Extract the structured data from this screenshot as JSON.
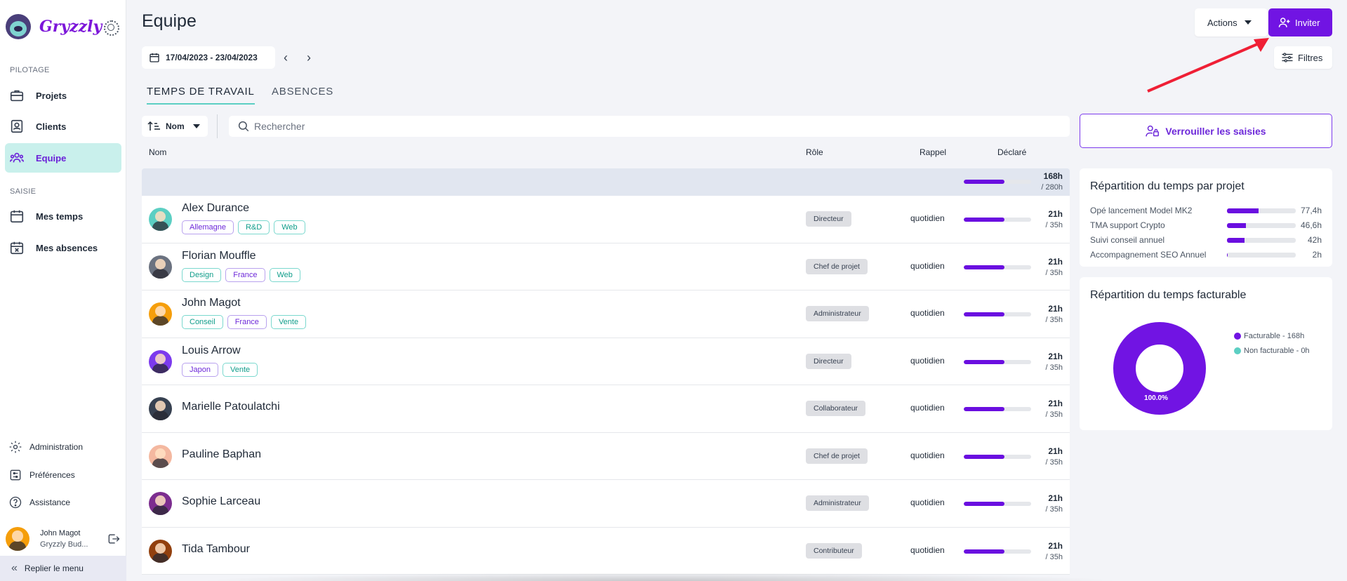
{
  "app": {
    "name": "Gryzzly"
  },
  "sidebar": {
    "sections": [
      {
        "label": "PILOTAGE",
        "items": [
          {
            "label": "Projets",
            "icon": "briefcase-icon"
          },
          {
            "label": "Clients",
            "icon": "contact-book-icon"
          },
          {
            "label": "Equipe",
            "icon": "team-icon",
            "active": true
          }
        ]
      },
      {
        "label": "SAISIE",
        "items": [
          {
            "label": "Mes temps",
            "icon": "calendar-icon"
          },
          {
            "label": "Mes absences",
            "icon": "calendar-x-icon"
          }
        ]
      }
    ],
    "bottom": [
      {
        "label": "Administration",
        "icon": "gear-icon"
      },
      {
        "label": "Préférences",
        "icon": "preferences-icon"
      },
      {
        "label": "Assistance",
        "icon": "help-icon"
      }
    ],
    "user": {
      "name": "John Magot",
      "org": "Gryzzly Bud..."
    },
    "collapse_label": "Replier le menu"
  },
  "header": {
    "title": "Equipe",
    "date_range": "17/04/2023 - 23/04/2023",
    "actions_label": "Actions",
    "invite_label": "Inviter",
    "filters_label": "Filtres"
  },
  "tabs": [
    {
      "label": "TEMPS DE TRAVAIL",
      "active": true
    },
    {
      "label": "ABSENCES",
      "active": false
    }
  ],
  "toolbar": {
    "sort_label": "Nom",
    "search_placeholder": "Rechercher"
  },
  "table": {
    "columns": {
      "name": "Nom",
      "role": "Rôle",
      "reminder": "Rappel",
      "declared": "Déclaré"
    },
    "total": {
      "hours": "168h",
      "target": "/ 280h",
      "progress": 0.6
    },
    "rows": [
      {
        "name": "Alex Durance",
        "tags": [
          {
            "label": "Allemagne",
            "color": "purple"
          },
          {
            "label": "R&D",
            "color": "teal"
          },
          {
            "label": "Web",
            "color": "teal"
          }
        ],
        "role": "Directeur",
        "reminder": "quotidien",
        "hours": "21h",
        "target": "/ 35h",
        "progress": 0.6,
        "avatar": "#5ccfc3"
      },
      {
        "name": "Florian Mouffle",
        "tags": [
          {
            "label": "Design",
            "color": "teal"
          },
          {
            "label": "France",
            "color": "purple"
          },
          {
            "label": "Web",
            "color": "teal"
          }
        ],
        "role": "Chef de projet",
        "reminder": "quotidien",
        "hours": "21h",
        "target": "/ 35h",
        "progress": 0.6,
        "avatar": "#6b7280"
      },
      {
        "name": "John Magot",
        "tags": [
          {
            "label": "Conseil",
            "color": "teal"
          },
          {
            "label": "France",
            "color": "purple"
          },
          {
            "label": "Vente",
            "color": "teal"
          }
        ],
        "role": "Administrateur",
        "reminder": "quotidien",
        "hours": "21h",
        "target": "/ 35h",
        "progress": 0.6,
        "avatar": "#f59e0b"
      },
      {
        "name": "Louis Arrow",
        "tags": [
          {
            "label": "Japon",
            "color": "purple"
          },
          {
            "label": "Vente",
            "color": "teal"
          }
        ],
        "role": "Directeur",
        "reminder": "quotidien",
        "hours": "21h",
        "target": "/ 35h",
        "progress": 0.6,
        "avatar": "#7c3aed"
      },
      {
        "name": "Marielle Patoulatchi",
        "tags": [],
        "role": "Collaborateur",
        "reminder": "quotidien",
        "hours": "21h",
        "target": "/ 35h",
        "progress": 0.6,
        "avatar": "#374151"
      },
      {
        "name": "Pauline Baphan",
        "tags": [],
        "role": "Chef de projet",
        "reminder": "quotidien",
        "hours": "21h",
        "target": "/ 35h",
        "progress": 0.6,
        "avatar": "#f4b8a0"
      },
      {
        "name": "Sophie Larceau",
        "tags": [],
        "role": "Administrateur",
        "reminder": "quotidien",
        "hours": "21h",
        "target": "/ 35h",
        "progress": 0.6,
        "avatar": "#7c2d8f"
      },
      {
        "name": "Tida Tambour",
        "tags": [],
        "role": "Contributeur",
        "reminder": "quotidien",
        "hours": "21h",
        "target": "/ 35h",
        "progress": 0.6,
        "avatar": "#92400e"
      }
    ]
  },
  "right_panel": {
    "lock_label": "Verrouiller les saisies",
    "projects_card": {
      "title": "Répartition du temps par projet",
      "items": [
        {
          "label": "Opé lancement Model MK2",
          "value": "77,4h",
          "progress": 0.46
        },
        {
          "label": "TMA support Crypto",
          "value": "46,6h",
          "progress": 0.28
        },
        {
          "label": "Suivi conseil annuel",
          "value": "42h",
          "progress": 0.25
        },
        {
          "label": "Accompagnement SEO Annuel",
          "value": "2h",
          "progress": 0.012
        }
      ]
    },
    "billable_card": {
      "title": "Répartition du temps facturable",
      "donut_label": "100.0%",
      "legend": [
        {
          "label": "Facturable - 168h",
          "color": "#7114e3",
          "value": 168
        },
        {
          "label": "Non facturable - 0h",
          "color": "#5ccfc3",
          "value": 0
        }
      ]
    }
  },
  "colors": {
    "accent": "#7114e3",
    "teal": "#5ccfc3",
    "active_bg": "#c9f0ec"
  }
}
